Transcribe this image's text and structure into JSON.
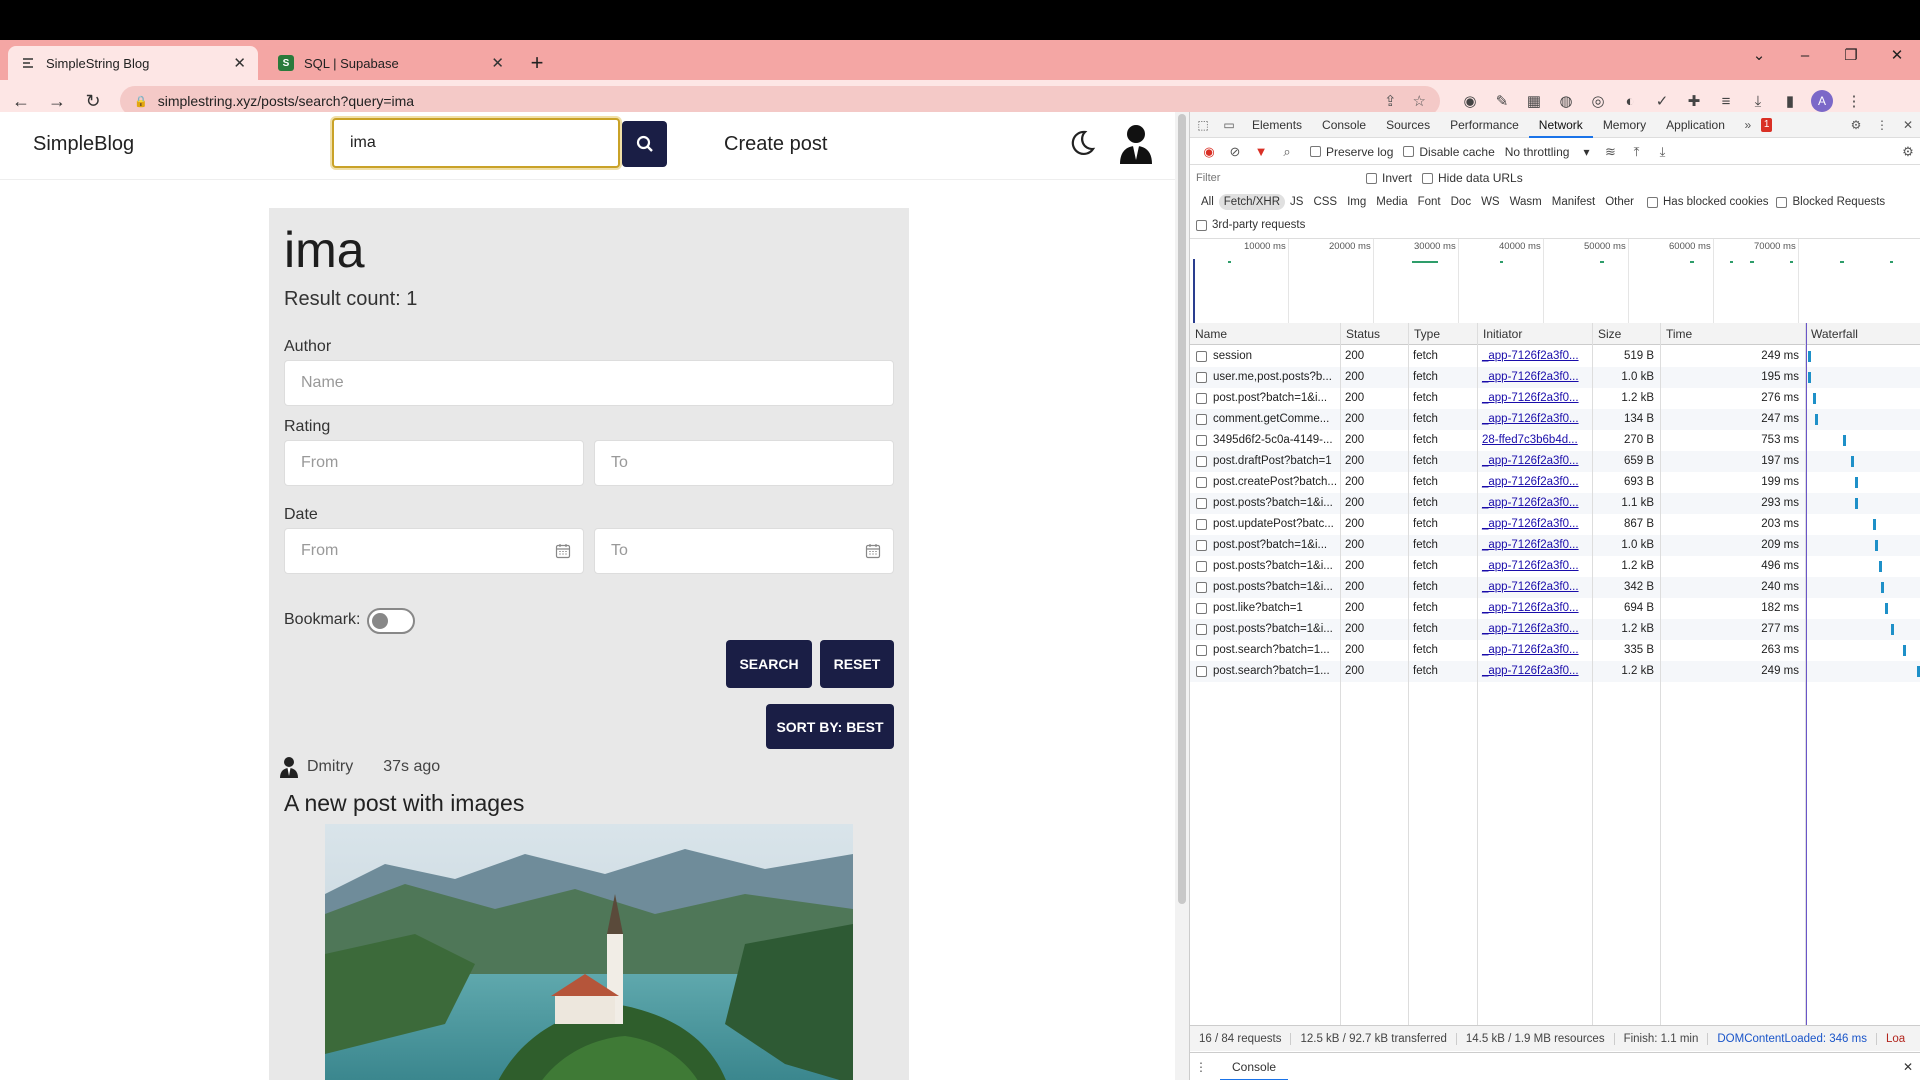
{
  "browser": {
    "tabs": [
      {
        "title": "SimpleString Blog",
        "active": true
      },
      {
        "title": "SQL | Supabase",
        "active": false
      }
    ],
    "url": "simplestring.xyz/posts/search?query=ima",
    "profile_initial": "A"
  },
  "site": {
    "brand": "SimpleBlog",
    "search_value": "ima",
    "create_post": "Create post"
  },
  "search": {
    "query_title": "ima",
    "result_count": "Result count: 1",
    "author_label": "Author",
    "author_placeholder": "Name",
    "rating_label": "Rating",
    "rating_from": "From",
    "rating_to": "To",
    "date_label": "Date",
    "date_from": "From",
    "date_to": "To",
    "bookmark_label": "Bookmark:",
    "bookmark_on": false,
    "search_btn": "SEARCH",
    "reset_btn": "RESET",
    "sort_btn": "SORT BY: BEST"
  },
  "post": {
    "author": "Dmitry",
    "time": "37s ago",
    "title": "A new post with images"
  },
  "devtools": {
    "tabs": [
      "Elements",
      "Console",
      "Sources",
      "Performance",
      "Network",
      "Memory",
      "Application"
    ],
    "active_tab": "Network",
    "error_count": "1",
    "toolbar": {
      "preserve_log": "Preserve log",
      "disable_cache": "Disable cache",
      "throttling": "No throttling"
    },
    "filter": {
      "placeholder": "Filter",
      "invert": "Invert",
      "hide_data_urls": "Hide data URLs"
    },
    "types": [
      "All",
      "Fetch/XHR",
      "JS",
      "CSS",
      "Img",
      "Media",
      "Font",
      "Doc",
      "WS",
      "Wasm",
      "Manifest",
      "Other"
    ],
    "selected_type": "Fetch/XHR",
    "has_blocked_cookies": "Has blocked cookies",
    "blocked_requests": "Blocked Requests",
    "third_party": "3rd-party requests",
    "timeline_ticks": [
      "10000 ms",
      "20000 ms",
      "30000 ms",
      "40000 ms",
      "50000 ms",
      "60000 ms",
      "70000 ms"
    ],
    "columns": [
      "Name",
      "Status",
      "Type",
      "Initiator",
      "Size",
      "Time",
      "Waterfall"
    ],
    "rows": [
      {
        "name": "session",
        "status": "200",
        "type": "fetch",
        "initiator": "_app-7126f2a3f0...",
        "size": "519 B",
        "time": "249 ms"
      },
      {
        "name": "user.me,post.posts?b...",
        "status": "200",
        "type": "fetch",
        "initiator": "_app-7126f2a3f0...",
        "size": "1.0 kB",
        "time": "195 ms"
      },
      {
        "name": "post.post?batch=1&i...",
        "status": "200",
        "type": "fetch",
        "initiator": "_app-7126f2a3f0...",
        "size": "1.2 kB",
        "time": "276 ms"
      },
      {
        "name": "comment.getComme...",
        "status": "200",
        "type": "fetch",
        "initiator": "_app-7126f2a3f0...",
        "size": "134 B",
        "time": "247 ms"
      },
      {
        "name": "3495d6f2-5c0a-4149-...",
        "status": "200",
        "type": "fetch",
        "initiator": "28-ffed7c3b6b4d...",
        "size": "270 B",
        "time": "753 ms"
      },
      {
        "name": "post.draftPost?batch=1",
        "status": "200",
        "type": "fetch",
        "initiator": "_app-7126f2a3f0...",
        "size": "659 B",
        "time": "197 ms"
      },
      {
        "name": "post.createPost?batch...",
        "status": "200",
        "type": "fetch",
        "initiator": "_app-7126f2a3f0...",
        "size": "693 B",
        "time": "199 ms"
      },
      {
        "name": "post.posts?batch=1&i...",
        "status": "200",
        "type": "fetch",
        "initiator": "_app-7126f2a3f0...",
        "size": "1.1 kB",
        "time": "293 ms"
      },
      {
        "name": "post.updatePost?batc...",
        "status": "200",
        "type": "fetch",
        "initiator": "_app-7126f2a3f0...",
        "size": "867 B",
        "time": "203 ms"
      },
      {
        "name": "post.post?batch=1&i...",
        "status": "200",
        "type": "fetch",
        "initiator": "_app-7126f2a3f0...",
        "size": "1.0 kB",
        "time": "209 ms"
      },
      {
        "name": "post.posts?batch=1&i...",
        "status": "200",
        "type": "fetch",
        "initiator": "_app-7126f2a3f0...",
        "size": "1.2 kB",
        "time": "496 ms"
      },
      {
        "name": "post.posts?batch=1&i...",
        "status": "200",
        "type": "fetch",
        "initiator": "_app-7126f2a3f0...",
        "size": "342 B",
        "time": "240 ms"
      },
      {
        "name": "post.like?batch=1",
        "status": "200",
        "type": "fetch",
        "initiator": "_app-7126f2a3f0...",
        "size": "694 B",
        "time": "182 ms"
      },
      {
        "name": "post.posts?batch=1&i...",
        "status": "200",
        "type": "fetch",
        "initiator": "_app-7126f2a3f0...",
        "size": "1.2 kB",
        "time": "277 ms"
      },
      {
        "name": "post.search?batch=1...",
        "status": "200",
        "type": "fetch",
        "initiator": "_app-7126f2a3f0...",
        "size": "335 B",
        "time": "263 ms"
      },
      {
        "name": "post.search?batch=1...",
        "status": "200",
        "type": "fetch",
        "initiator": "_app-7126f2a3f0...",
        "size": "1.2 kB",
        "time": "249 ms"
      }
    ],
    "status_bar": {
      "requests": "16 / 84 requests",
      "transferred": "12.5 kB / 92.7 kB transferred",
      "resources": "14.5 kB / 1.9 MB resources",
      "finish": "Finish: 1.1 min",
      "dcl": "DOMContentLoaded: 346 ms",
      "load": "Loa"
    },
    "drawer_tab": "Console"
  }
}
